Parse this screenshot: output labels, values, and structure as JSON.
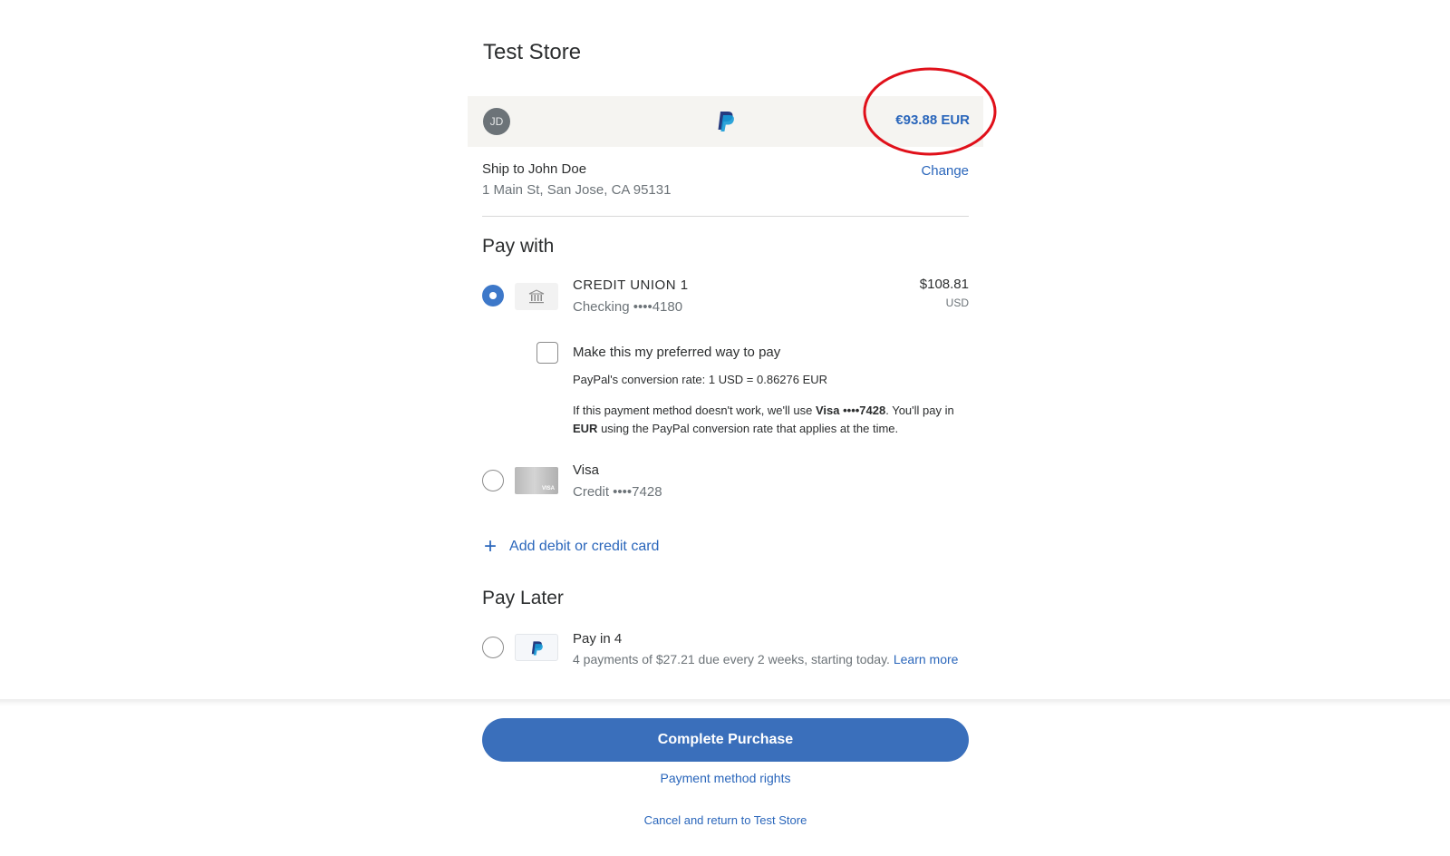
{
  "store": {
    "name": "Test Store"
  },
  "header": {
    "avatar_initials": "JD",
    "total": "€93.88 EUR",
    "highlight_color": "#e0101a"
  },
  "shipping": {
    "label": "Ship to John Doe",
    "address": "1 Main St, San Jose, CA 95131",
    "change_label": "Change"
  },
  "pay_with": {
    "title": "Pay with",
    "methods": [
      {
        "name": "CREDIT UNION 1",
        "sub": "Checking ••••4180",
        "amount": "$108.81",
        "currency": "USD",
        "selected": true,
        "icon": "bank-icon"
      },
      {
        "name": "Visa",
        "sub": "Credit ••••7428",
        "card_mark": "VISA",
        "selected": false,
        "icon": "visa-card-icon"
      }
    ],
    "preferred_label": "Make this my preferred way to pay",
    "conversion_rate": "PayPal's conversion rate: 1 USD = 0.86276 EUR",
    "fallback": {
      "part1": "If this payment method doesn't work, we'll use ",
      "card": "Visa ••••7428",
      "part2": ". You'll pay in ",
      "currency": "EUR",
      "part3": " using the PayPal conversion rate that applies at the time."
    },
    "add_card_label": "Add debit or credit card"
  },
  "pay_later": {
    "title": "Pay Later",
    "option": {
      "name": "Pay in 4",
      "sub": "4 payments of $27.21 due every 2 weeks, starting today.",
      "learn_more": "Learn more",
      "selected": false
    }
  },
  "footer": {
    "complete_label": "Complete Purchase",
    "rights_label": "Payment method rights",
    "cancel_label": "Cancel and return to Test Store"
  },
  "colors": {
    "accent": "#2a66bb",
    "button": "#3a6fbb",
    "radio_selected": "#3d78c9",
    "header_bg": "#f5f4f1"
  }
}
